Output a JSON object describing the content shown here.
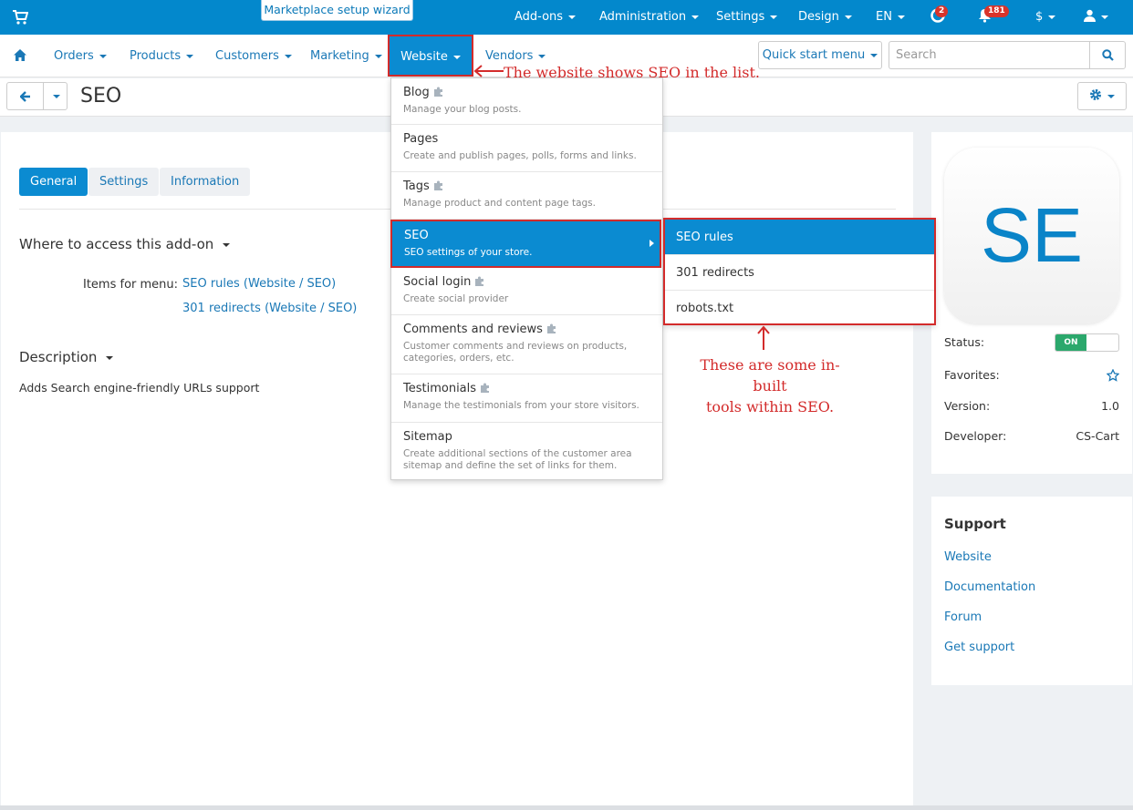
{
  "topbar": {
    "wizard_label": "Marketplace setup wizard",
    "addons": "Add-ons",
    "administration": "Administration",
    "settings": "Settings",
    "design": "Design",
    "language": "EN",
    "notifications_count": "2",
    "messages_count": "181",
    "currency": "$",
    "icons": [
      "cart-icon",
      "lifebuoy-icon",
      "bell-icon",
      "user-icon"
    ]
  },
  "mainnav": {
    "orders": "Orders",
    "products": "Products",
    "customers": "Customers",
    "marketing": "Marketing",
    "website": "Website",
    "vendors": "Vendors",
    "quick_start": "Quick start menu",
    "search_placeholder": "Search"
  },
  "titlebar": {
    "title": "SEO"
  },
  "tabs": {
    "general": "General",
    "settings": "Settings",
    "information": "Information"
  },
  "content": {
    "access_heading": "Where to access this add-on",
    "items_for_menu_label": "Items for menu:",
    "link_seo_rules": "SEO rules (Website / SEO)",
    "link_301": "301 redirects (Website / SEO)",
    "description_heading": "Description",
    "description_text": "Adds Search engine-friendly URLs support"
  },
  "dropdown": {
    "items": [
      {
        "title": "Blog",
        "sub": "Manage your blog posts."
      },
      {
        "title": "Pages",
        "sub": "Create and publish pages, polls, forms and links."
      },
      {
        "title": "Tags",
        "sub": "Manage product and content page tags."
      },
      {
        "title": "SEO",
        "sub": "SEO settings of your store."
      },
      {
        "title": "Social login",
        "sub": "Create social provider"
      },
      {
        "title": "Comments and reviews",
        "sub": "Customer comments and reviews on products, categories, orders, etc."
      },
      {
        "title": "Testimonials",
        "sub": "Manage the testimonials from your store visitors."
      },
      {
        "title": "Sitemap",
        "sub": "Create additional sections of the customer area sitemap and define the set of links for them."
      }
    ]
  },
  "submenu": {
    "items": [
      "SEO rules",
      "301 redirects",
      "robots.txt"
    ]
  },
  "annotations": {
    "website_note": "The website shows SEO in the list.",
    "tools_note_line1": "These are some in-built",
    "tools_note_line2": "tools within SEO."
  },
  "sidebar": {
    "logo_text": "SE",
    "status_label": "Status:",
    "status_value": "ON",
    "favorites_label": "Favorites:",
    "version_label": "Version:",
    "version_value": "1.0",
    "developer_label": "Developer:",
    "developer_value": "CS-Cart"
  },
  "support": {
    "heading": "Support",
    "website": "Website",
    "documentation": "Documentation",
    "forum": "Forum",
    "get_support": "Get support"
  },
  "colors": {
    "topbar": "#0388cc",
    "accent": "#0b8bd1",
    "link": "#1a78b6",
    "annotation": "#d32b2b",
    "status_on": "#2ba86c"
  }
}
